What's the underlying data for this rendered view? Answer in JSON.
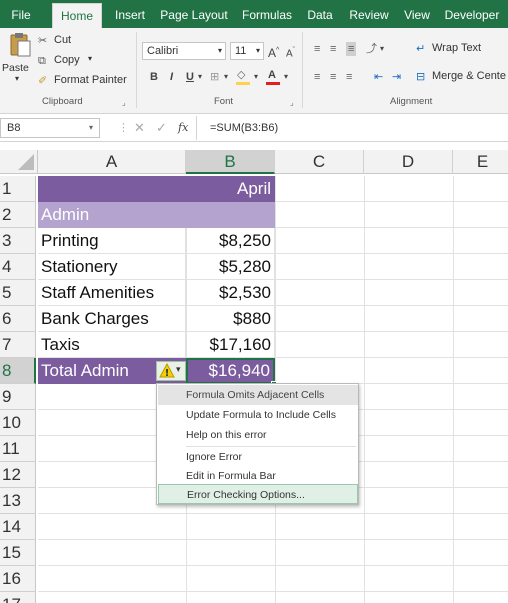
{
  "tabs": [
    "File",
    "Home",
    "Insert",
    "Page Layout",
    "Formulas",
    "Data",
    "Review",
    "View",
    "Developer"
  ],
  "clipboard": {
    "paste": "Paste",
    "cut": "Cut",
    "copy": "Copy",
    "format_painter": "Format Painter",
    "label": "Clipboard"
  },
  "font": {
    "name": "Calibri",
    "size": "11",
    "label": "Font"
  },
  "alignment": {
    "wrap_text": "Wrap Text",
    "merge_center": "Merge & Cente",
    "label": "Alignment"
  },
  "formula_bar": {
    "name_box": "B8",
    "fx": "fx",
    "formula": "=SUM(B3:B6)"
  },
  "columns": [
    "A",
    "B",
    "C",
    "D",
    "E"
  ],
  "rows": [
    "1",
    "2",
    "3",
    "4",
    "5",
    "6",
    "7",
    "8",
    "9",
    "10",
    "11",
    "12",
    "13",
    "14",
    "15",
    "16",
    "17"
  ],
  "cells": {
    "b1": "April",
    "a2": "Admin",
    "a3": "Printing",
    "b3": "$8,250",
    "a4": "Stationery",
    "b4": "$5,280",
    "a5": "Staff Amenities",
    "b5": "$2,530",
    "a6": "Bank Charges",
    "b6": "$880",
    "a7": "Taxis",
    "b7": "$17,160",
    "a8": "Total Admin",
    "b8": "$16,940"
  },
  "error_menu": {
    "title": "Formula Omits Adjacent Cells",
    "items": [
      "Update Formula to Include Cells",
      "Help on this error",
      "Ignore Error",
      "Edit in Formula Bar",
      "Error Checking Options..."
    ]
  },
  "colors": {
    "excel_green": "#217346",
    "header_purple": "#7b5c9f",
    "admin_purple": "#b4a2cf"
  }
}
